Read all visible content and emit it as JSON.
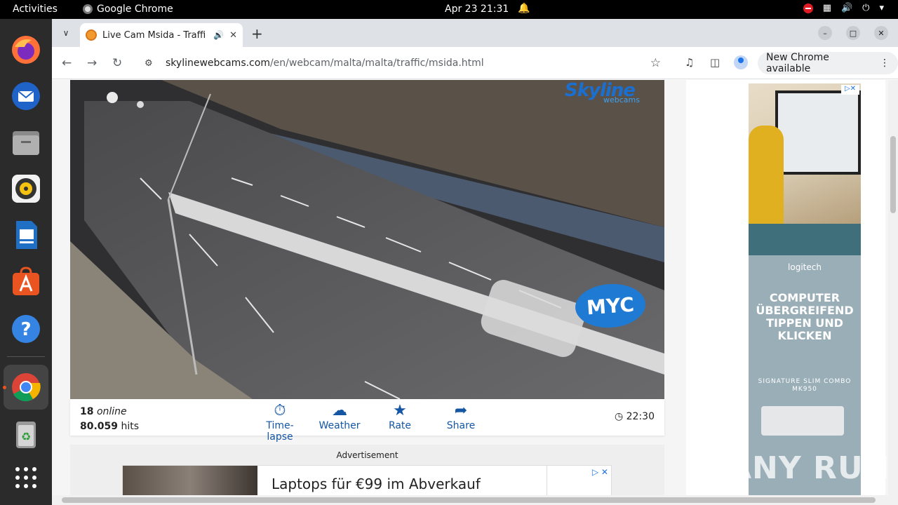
{
  "topbar": {
    "activities": "Activities",
    "app_name": "Google Chrome",
    "datetime": "Apr 23  21:31"
  },
  "dock": {
    "items": [
      "firefox-icon",
      "thunderbird-icon",
      "files-icon",
      "rhythmbox-icon",
      "writer-icon",
      "app-center-icon",
      "help-icon",
      "chrome-icon",
      "trash-icon",
      "apps-grid-icon"
    ]
  },
  "browser": {
    "tab_title": "Live Cam Msida - Traffi",
    "url_host": "skylinewebcams.com",
    "url_path": "/en/webcam/malta/malta/traffic/msida.html",
    "update_label": "New Chrome available"
  },
  "webcam": {
    "logo_main": "Skyline",
    "logo_sub": "webcams",
    "badge": "MYC",
    "online_count": "18",
    "online_label": "online",
    "hits_count": "80.059",
    "hits_label": "hits",
    "actions": [
      {
        "label": "Time-lapse",
        "icon": "timelapse-icon"
      },
      {
        "label": "Weather",
        "icon": "weather-icon"
      },
      {
        "label": "Rate",
        "icon": "star-icon"
      },
      {
        "label": "Share",
        "icon": "share-icon"
      }
    ],
    "local_time": "22:30"
  },
  "advert": {
    "label": "Advertisement",
    "banner_text": "Laptops für €99 im Abverkauf"
  },
  "side_ad": {
    "brand": "logitech",
    "headline": "COMPUTER ÜBERGREIFEND TIPPEN UND KLICKEN",
    "product": "SIGNATURE SLIM COMBO MK950"
  },
  "watermark": "ANY RUN"
}
